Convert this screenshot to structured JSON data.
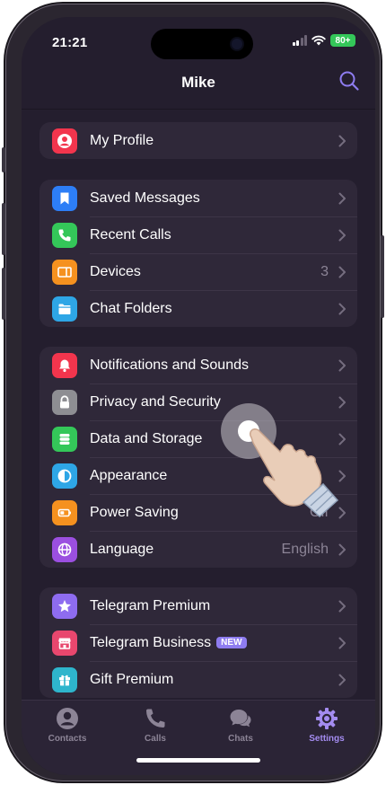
{
  "status": {
    "time": "21:21",
    "battery": "80+"
  },
  "header": {
    "title": "Mike",
    "search_icon": "search-icon",
    "accent": "#8e7cf0"
  },
  "groups": [
    {
      "items": [
        {
          "label": "My Profile",
          "icon": "profile-icon",
          "color": "#f2354d"
        }
      ]
    },
    {
      "items": [
        {
          "label": "Saved Messages",
          "icon": "bookmark-icon",
          "color": "#2d7ef6"
        },
        {
          "label": "Recent Calls",
          "icon": "phone-icon",
          "color": "#34c759"
        },
        {
          "label": "Devices",
          "icon": "devices-icon",
          "color": "#f5911f",
          "value": "3"
        },
        {
          "label": "Chat Folders",
          "icon": "folder-icon",
          "color": "#2ea6e6"
        }
      ]
    },
    {
      "items": [
        {
          "label": "Notifications and Sounds",
          "icon": "bell-icon",
          "color": "#f2354d"
        },
        {
          "label": "Privacy and Security",
          "icon": "lock-icon",
          "color": "#8e8e93"
        },
        {
          "label": "Data and Storage",
          "icon": "database-icon",
          "color": "#34c759"
        },
        {
          "label": "Appearance",
          "icon": "half-circle-icon",
          "color": "#2ea6e6"
        },
        {
          "label": "Power Saving",
          "icon": "battery-icon",
          "color": "#f5911f",
          "value": "Off"
        },
        {
          "label": "Language",
          "icon": "globe-icon",
          "color": "#9b4fe0",
          "value": "English"
        }
      ]
    },
    {
      "items": [
        {
          "label": "Telegram Premium",
          "icon": "star-icon",
          "color": "#8e6cf0"
        },
        {
          "label": "Telegram Business",
          "icon": "store-icon",
          "color": "#e8476e",
          "badge": "NEW"
        },
        {
          "label": "Gift Premium",
          "icon": "gift-icon",
          "color": "#2eb5cc"
        }
      ]
    }
  ],
  "tabs": [
    {
      "label": "Contacts",
      "icon": "contacts-icon"
    },
    {
      "label": "Calls",
      "icon": "calls-icon"
    },
    {
      "label": "Chats",
      "icon": "chats-icon"
    },
    {
      "label": "Settings",
      "icon": "settings-icon",
      "active": true
    }
  ]
}
